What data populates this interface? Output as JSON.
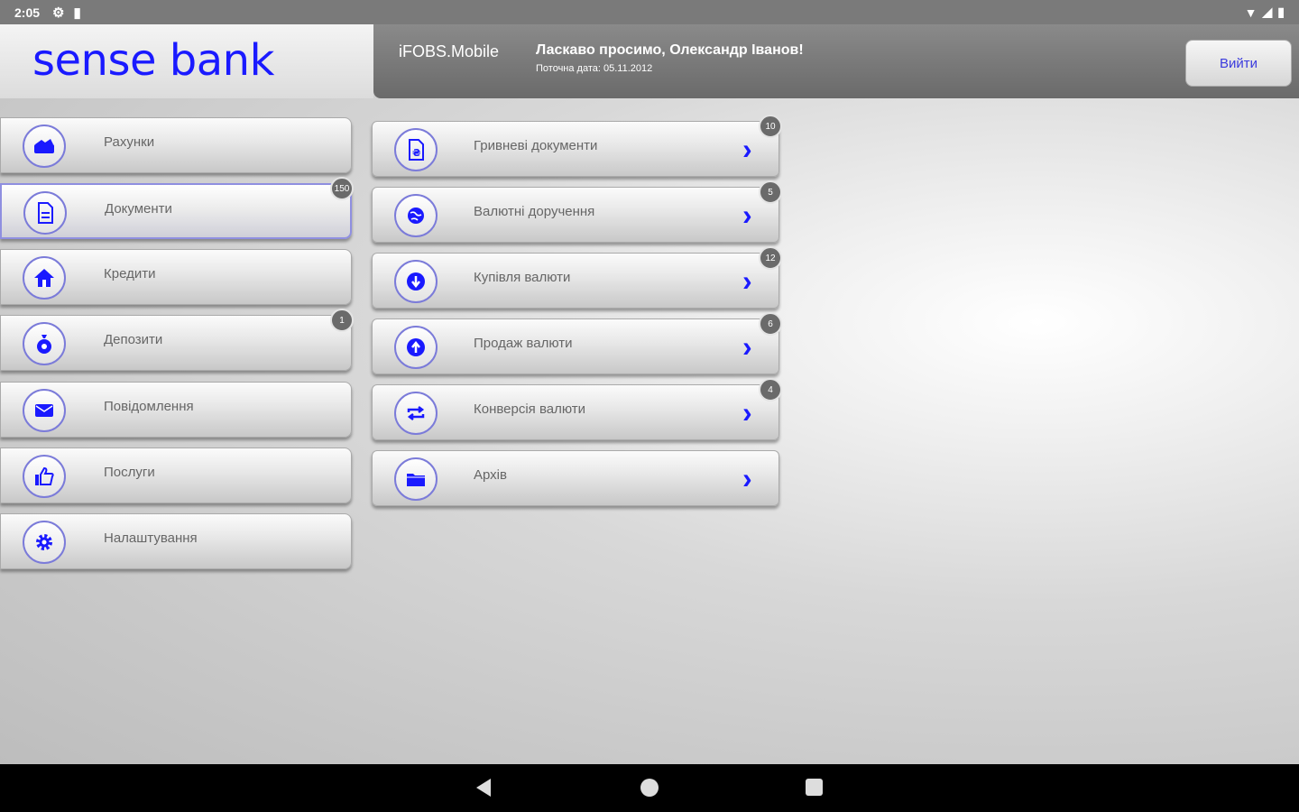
{
  "status_bar": {
    "time": "2:05",
    "settings_icon": "gear-icon",
    "sd_icon": "sd-card-icon",
    "wifi_icon": "wifi-icon",
    "signal_icon": "signal-icon",
    "battery_icon": "battery-icon"
  },
  "header": {
    "logo": "sense bank",
    "app_name": "iFOBS.Mobile",
    "welcome": "Ласкаво просимо, Олександр Іванов!",
    "date": "Поточна дата: 05.11.2012",
    "logout_label": "Вийти"
  },
  "menu": {
    "items": [
      {
        "label": "Рахунки",
        "icon": "wallet-icon",
        "badge": null
      },
      {
        "label": "Документи",
        "icon": "document-icon",
        "badge": "150"
      },
      {
        "label": "Кредити",
        "icon": "house-icon",
        "badge": null
      },
      {
        "label": "Депозити",
        "icon": "money-bag-icon",
        "badge": "1"
      },
      {
        "label": "Повідомлення",
        "icon": "envelope-icon",
        "badge": null
      },
      {
        "label": "Послуги",
        "icon": "thumbs-up-icon",
        "badge": null
      },
      {
        "label": "Налаштування",
        "icon": "gear-icon",
        "badge": null
      }
    ]
  },
  "submenu": {
    "items": [
      {
        "label": "Гривневі документи",
        "icon": "hryvnia-document-icon",
        "badge": "10"
      },
      {
        "label": "Валютні доручення",
        "icon": "globe-icon",
        "badge": "5"
      },
      {
        "label": "Купівля валюти",
        "icon": "arrow-down-circle-icon",
        "badge": "12"
      },
      {
        "label": "Продаж валюти",
        "icon": "arrow-up-circle-icon",
        "badge": "6"
      },
      {
        "label": "Конверсія валюти",
        "icon": "convert-icon",
        "badge": "4"
      },
      {
        "label": "Архів",
        "icon": "folder-icon",
        "badge": null
      }
    ]
  },
  "colors": {
    "accent": "#1a1aff",
    "header_bg": "#777777",
    "badge_bg": "#6a6a6a"
  }
}
